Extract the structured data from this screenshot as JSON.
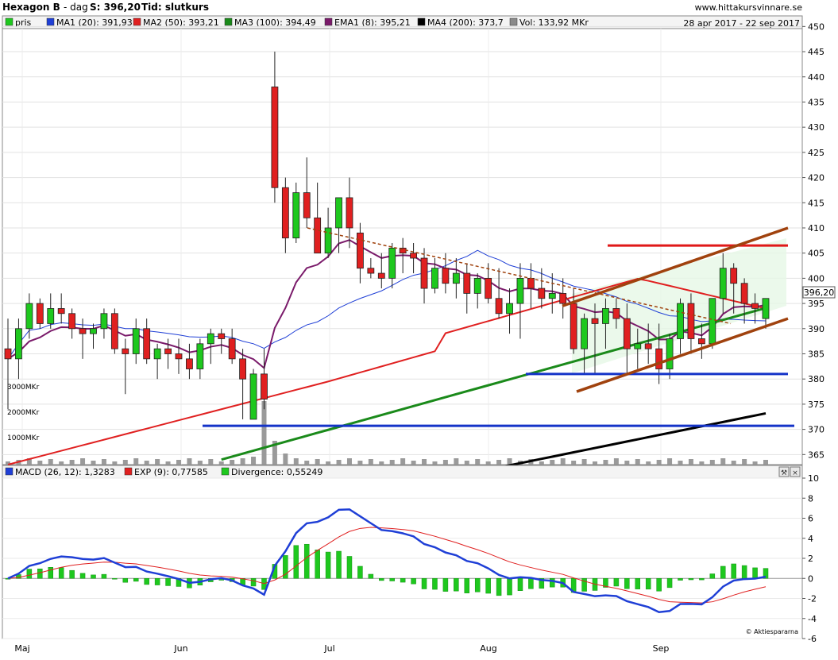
{
  "header": {
    "title": "Hexagon B",
    "interval": "- dag",
    "last": "S: 396,20",
    "mode": "Tid: slutkurs",
    "site": "www.hittakursvinnare.se",
    "range": "28 apr 2017 - 22 sep 2017"
  },
  "legend": [
    {
      "label": "pris",
      "color": "#1ec81e"
    },
    {
      "label": "MA1 (20): 391,93",
      "color": "#1f3fd6"
    },
    {
      "label": "MA2 (50): 393,21",
      "color": "#e02020"
    },
    {
      "label": "MA3 (100): 394,49",
      "color": "#1a8a1a"
    },
    {
      "label": "EMA1 (8): 395,21",
      "color": "#7a1a6a"
    },
    {
      "label": "MA4 (200): 373,7",
      "color": "#000000"
    },
    {
      "label": "Vol: 133,92 MKr",
      "color": "#8a8a8a"
    }
  ],
  "macd_legend": [
    {
      "label": "MACD (26, 12): 1,3283",
      "color": "#1f3fd6"
    },
    {
      "label": "EXP (9): 0,77585",
      "color": "#e02020"
    },
    {
      "label": "Divergence: 0,55249",
      "color": "#1ec81e"
    }
  ],
  "last_price_label": "396,20",
  "volume_labels": [
    "3000MKr",
    "2000MKr",
    "1000MKr"
  ],
  "x_labels": [
    "Maj",
    "Jun",
    "Jul",
    "Aug",
    "Sep"
  ],
  "y_ticks": [
    "450",
    "445",
    "440",
    "435",
    "430",
    "425",
    "420",
    "415",
    "410",
    "405",
    "400",
    "395",
    "390",
    "385",
    "380",
    "375",
    "370",
    "365"
  ],
  "macd_ticks": [
    "10",
    "8",
    "6",
    "4",
    "2",
    "0",
    "-2",
    "-4",
    "-6"
  ],
  "copyright": "© Aktiespararna",
  "chart_data": [
    {
      "type": "candlestick",
      "title": "Hexagon B",
      "ylim": [
        363,
        451
      ],
      "x": [
        "Maj",
        "Jun",
        "Jul",
        "Aug",
        "Sep"
      ],
      "series": [
        {
          "name": "pris",
          "ohlc": [
            [
              386,
              392,
              374,
              384
            ],
            [
              384,
              392,
              380,
              390
            ],
            [
              390,
              397,
              388,
              395
            ],
            [
              395,
              396,
              390,
              391
            ],
            [
              391,
              397,
              390,
              394
            ],
            [
              394,
              397,
              391,
              393
            ],
            [
              393,
              394,
              388,
              390
            ],
            [
              390,
              392,
              384,
              389
            ],
            [
              389,
              391,
              386,
              390
            ],
            [
              390,
              394,
              388,
              393
            ],
            [
              393,
              394,
              385,
              386
            ],
            [
              386,
              388,
              377,
              385
            ],
            [
              385,
              392,
              383,
              390
            ],
            [
              390,
              392,
              383,
              384
            ],
            [
              384,
              387,
              380,
              386
            ],
            [
              386,
              388,
              382,
              385
            ],
            [
              385,
              388,
              381,
              384
            ],
            [
              384,
              387,
              380,
              382
            ],
            [
              382,
              388,
              380,
              387
            ],
            [
              387,
              390,
              383,
              389
            ],
            [
              389,
              390,
              385,
              388
            ],
            [
              388,
              390,
              383,
              384
            ],
            [
              384,
              386,
              372,
              380
            ],
            [
              372,
              382,
              372,
              381
            ],
            [
              381,
              386,
              374,
              376
            ],
            [
              438,
              445,
              415,
              418
            ],
            [
              418,
              420,
              405,
              408
            ],
            [
              408,
              419,
              407,
              417
            ],
            [
              417,
              424,
              410,
              412
            ],
            [
              412,
              419,
              408,
              405
            ],
            [
              405,
              414,
              404,
              410
            ],
            [
              410,
              415,
              405,
              416
            ],
            [
              416,
              420,
              406,
              410
            ],
            [
              409,
              411,
              399,
              402
            ],
            [
              402,
              404,
              400,
              401
            ],
            [
              401,
              405,
              398,
              400
            ],
            [
              400,
              407,
              398,
              406
            ],
            [
              406,
              408,
              401,
              405
            ],
            [
              405,
              407,
              401,
              404
            ],
            [
              404,
              406,
              395,
              398
            ],
            [
              398,
              404,
              397,
              402
            ],
            [
              402,
              405,
              397,
              399
            ],
            [
              399,
              404,
              396,
              401
            ],
            [
              401,
              403,
              393,
              397
            ],
            [
              397,
              401,
              394,
              400
            ],
            [
              400,
              403,
              395,
              396
            ],
            [
              396,
              402,
              392,
              393
            ],
            [
              393,
              398,
              389,
              395
            ],
            [
              395,
              403,
              388,
              400
            ],
            [
              400,
              403,
              394,
              398
            ],
            [
              398,
              402,
              394,
              396
            ],
            [
              396,
              401,
              393,
              397
            ],
            [
              397,
              400,
              392,
              395
            ],
            [
              395,
              398,
              385,
              386
            ],
            [
              386,
              393,
              381,
              392
            ],
            [
              392,
              395,
              381,
              391
            ],
            [
              391,
              396,
              386,
              394
            ],
            [
              394,
              396,
              390,
              392
            ],
            [
              392,
              395,
              381,
              386
            ],
            [
              386,
              390,
              382,
              387
            ],
            [
              387,
              391,
              383,
              386
            ],
            [
              386,
              391,
              379,
              382
            ],
            [
              382,
              389,
              380,
              388
            ],
            [
              388,
              396,
              385,
              395
            ],
            [
              395,
              397,
              385,
              388
            ],
            [
              388,
              391,
              384,
              387
            ],
            [
              387,
              396,
              386,
              396
            ],
            [
              396,
              405,
              393,
              402
            ],
            [
              402,
              403,
              393,
              399
            ],
            [
              399,
              400,
              391,
              395
            ],
            [
              395,
              397,
              391,
              394
            ],
            [
              392,
              396,
              390,
              396
            ]
          ]
        },
        {
          "name": "MA1 (20)",
          "last": 391.93
        },
        {
          "name": "MA2 (50)",
          "last": 393.21
        },
        {
          "name": "MA3 (100)",
          "last": 394.49
        },
        {
          "name": "EMA1 (8)",
          "last": 395.21
        },
        {
          "name": "MA4 (200)",
          "last": 373.7
        },
        {
          "name": "Vol",
          "last": 133.92
        }
      ]
    },
    {
      "type": "bar",
      "title": "MACD (26, 12)",
      "ylim": [
        -6,
        10
      ],
      "series": [
        {
          "name": "MACD (26, 12)",
          "last": 1.3283
        },
        {
          "name": "EXP (9)",
          "last": 0.77585
        },
        {
          "name": "Divergence",
          "last": 0.55249
        }
      ]
    }
  ]
}
